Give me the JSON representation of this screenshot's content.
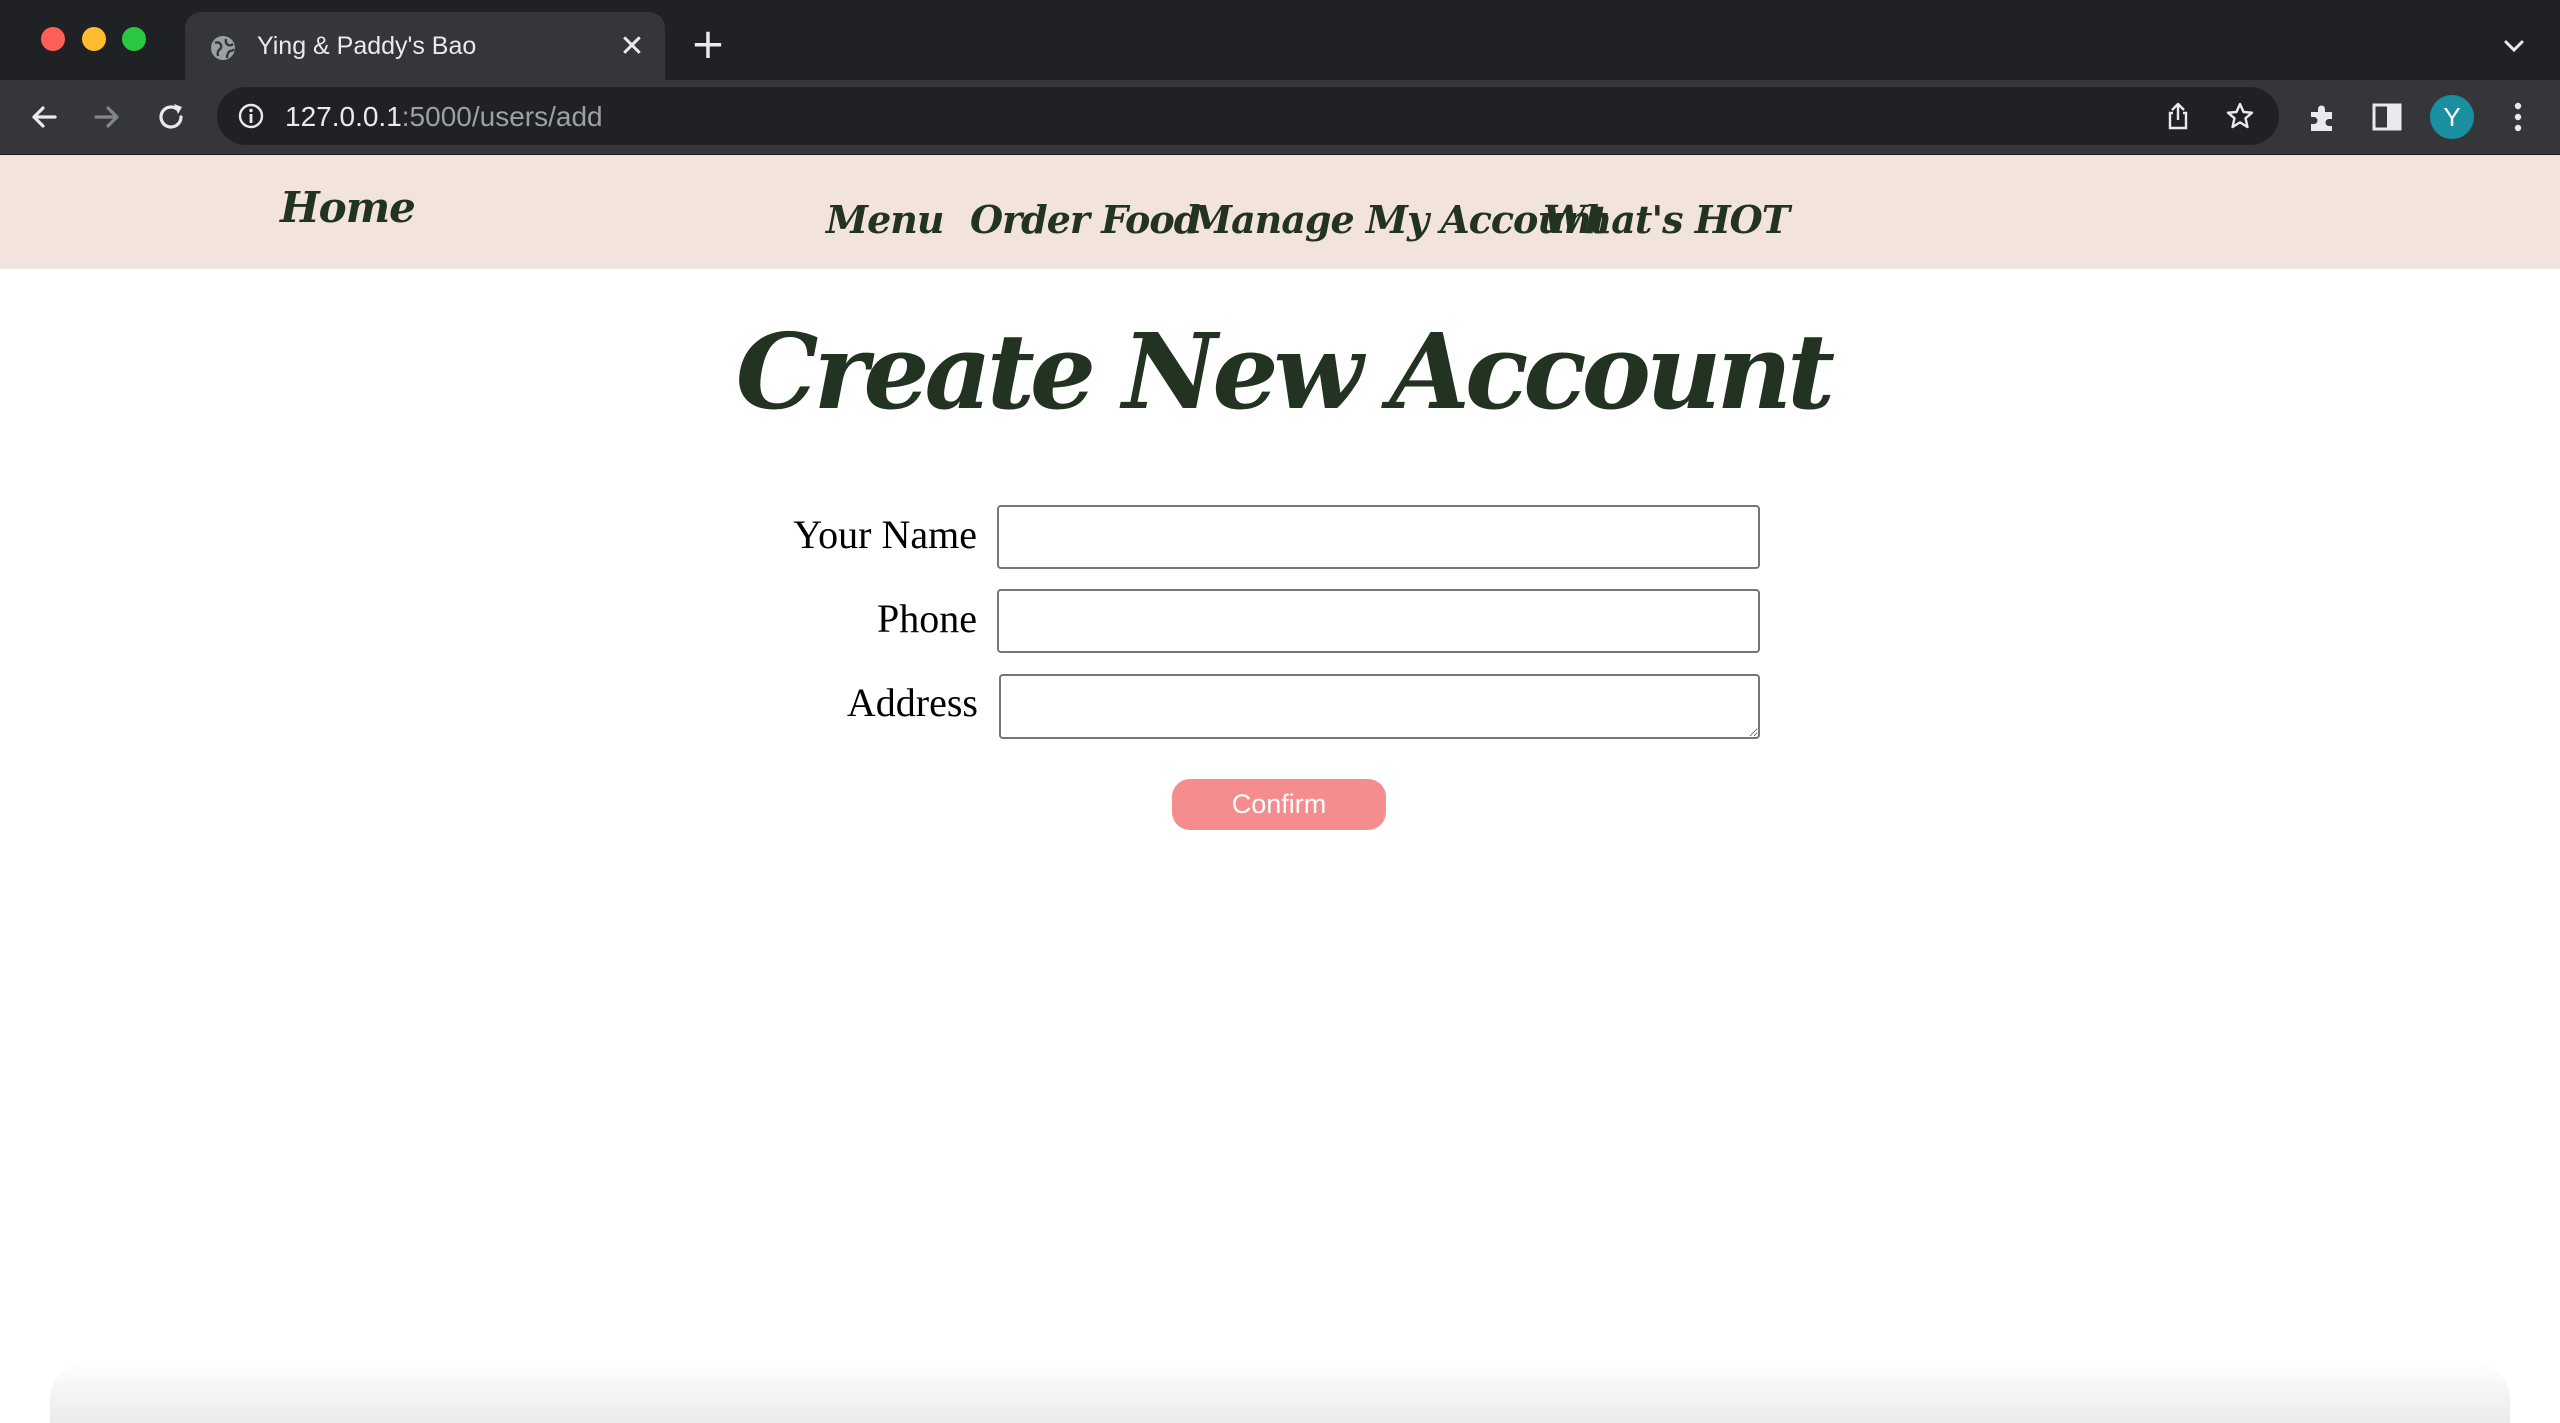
{
  "browser": {
    "tab_title": "Ying & Paddy's Bao",
    "tab_close_glyph": "✕",
    "new_tab_glyph": "+",
    "url_host": "127.0.0.1",
    "url_path": ":5000/users/add",
    "avatar_letter": "Y",
    "avatar_color": "#1a8fa0",
    "icons": [
      "globe-icon",
      "close-icon",
      "plus-icon",
      "chevron-down-icon",
      "back-arrow-icon",
      "forward-arrow-icon",
      "reload-icon",
      "info-icon",
      "share-icon",
      "star-icon",
      "puzzle-extension-icon",
      "side-panel-icon",
      "kebab-menu-icon"
    ]
  },
  "site_nav": {
    "home": "Home",
    "menu": "Menu",
    "order_food": "Order Food",
    "manage_account": "Manage My Account",
    "whats_hot": "What's HOT",
    "background_color": "#f2e3dc",
    "text_color": "#223322"
  },
  "page": {
    "title": "Create New Account"
  },
  "form": {
    "name_label": "Your Name",
    "name_value": "",
    "phone_label": "Phone",
    "phone_value": "",
    "address_label": "Address",
    "address_value": "",
    "confirm_label": "Confirm",
    "confirm_color": "#f58d8f"
  }
}
